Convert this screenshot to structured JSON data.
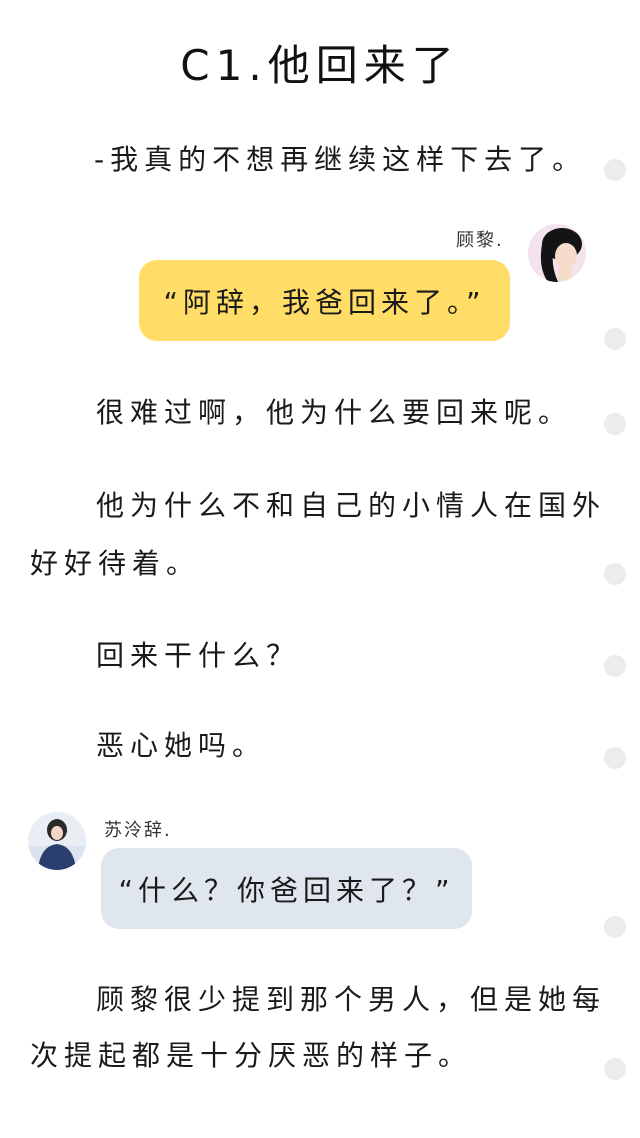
{
  "chapter": {
    "title": "C1.他回来了"
  },
  "paragraphs": [
    {
      "text": "-我真的不想再继续这样下去了。"
    },
    {
      "text": "很难过啊，他为什么要回来呢。"
    },
    {
      "text": "他为什么不和自己的小情人在国外"
    },
    {
      "text": "好好待着。"
    },
    {
      "text": "回来干什么？"
    },
    {
      "text": "恶心她吗。"
    },
    {
      "text": "顾黎很少提到那个男人，但是她每"
    },
    {
      "text": "次提起都是十分厌恶的样子。"
    }
  ],
  "chat": [
    {
      "speaker": "顾黎.",
      "side": "right",
      "message": "“阿辞，我爸回来了。”",
      "bubble_color": "#ffdd66",
      "avatar": "avatar-gu-li"
    },
    {
      "speaker": "苏泠辞.",
      "side": "left",
      "message": "“什么？你爸回来了？”",
      "bubble_color": "#dfe6ee",
      "avatar": "avatar-su-lingci"
    }
  ],
  "colors": {
    "background": "#ffffff",
    "yellow_bubble": "#ffdd66",
    "blue_bubble": "#dfe6ee",
    "scroll_dot": "#ececec"
  }
}
